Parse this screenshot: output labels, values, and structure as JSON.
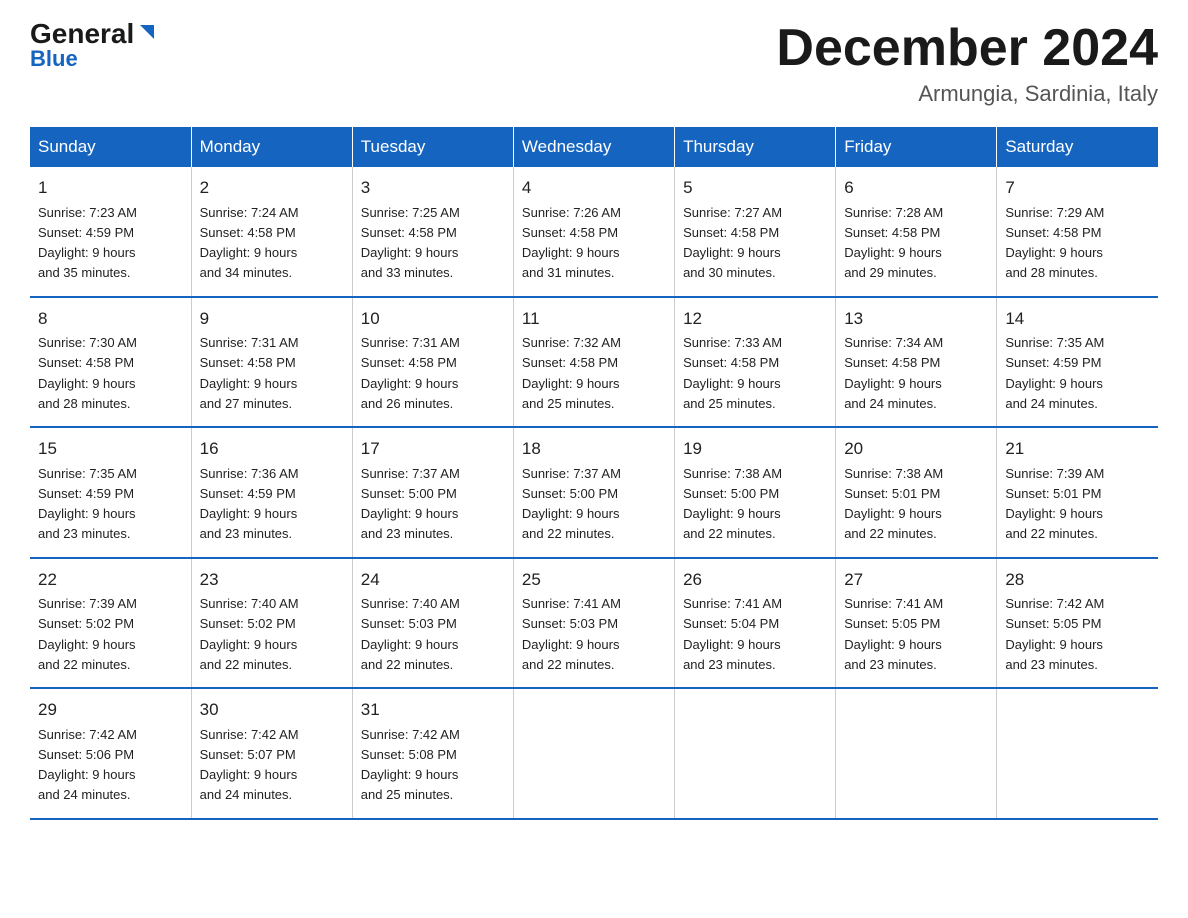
{
  "logo": {
    "general": "General",
    "blue": "Blue"
  },
  "title": "December 2024",
  "subtitle": "Armungia, Sardinia, Italy",
  "days_of_week": [
    "Sunday",
    "Monday",
    "Tuesday",
    "Wednesday",
    "Thursday",
    "Friday",
    "Saturday"
  ],
  "weeks": [
    [
      {
        "day": "1",
        "sunrise": "7:23 AM",
        "sunset": "4:59 PM",
        "daylight": "9 hours and 35 minutes."
      },
      {
        "day": "2",
        "sunrise": "7:24 AM",
        "sunset": "4:58 PM",
        "daylight": "9 hours and 34 minutes."
      },
      {
        "day": "3",
        "sunrise": "7:25 AM",
        "sunset": "4:58 PM",
        "daylight": "9 hours and 33 minutes."
      },
      {
        "day": "4",
        "sunrise": "7:26 AM",
        "sunset": "4:58 PM",
        "daylight": "9 hours and 31 minutes."
      },
      {
        "day": "5",
        "sunrise": "7:27 AM",
        "sunset": "4:58 PM",
        "daylight": "9 hours and 30 minutes."
      },
      {
        "day": "6",
        "sunrise": "7:28 AM",
        "sunset": "4:58 PM",
        "daylight": "9 hours and 29 minutes."
      },
      {
        "day": "7",
        "sunrise": "7:29 AM",
        "sunset": "4:58 PM",
        "daylight": "9 hours and 28 minutes."
      }
    ],
    [
      {
        "day": "8",
        "sunrise": "7:30 AM",
        "sunset": "4:58 PM",
        "daylight": "9 hours and 28 minutes."
      },
      {
        "day": "9",
        "sunrise": "7:31 AM",
        "sunset": "4:58 PM",
        "daylight": "9 hours and 27 minutes."
      },
      {
        "day": "10",
        "sunrise": "7:31 AM",
        "sunset": "4:58 PM",
        "daylight": "9 hours and 26 minutes."
      },
      {
        "day": "11",
        "sunrise": "7:32 AM",
        "sunset": "4:58 PM",
        "daylight": "9 hours and 25 minutes."
      },
      {
        "day": "12",
        "sunrise": "7:33 AM",
        "sunset": "4:58 PM",
        "daylight": "9 hours and 25 minutes."
      },
      {
        "day": "13",
        "sunrise": "7:34 AM",
        "sunset": "4:58 PM",
        "daylight": "9 hours and 24 minutes."
      },
      {
        "day": "14",
        "sunrise": "7:35 AM",
        "sunset": "4:59 PM",
        "daylight": "9 hours and 24 minutes."
      }
    ],
    [
      {
        "day": "15",
        "sunrise": "7:35 AM",
        "sunset": "4:59 PM",
        "daylight": "9 hours and 23 minutes."
      },
      {
        "day": "16",
        "sunrise": "7:36 AM",
        "sunset": "4:59 PM",
        "daylight": "9 hours and 23 minutes."
      },
      {
        "day": "17",
        "sunrise": "7:37 AM",
        "sunset": "5:00 PM",
        "daylight": "9 hours and 23 minutes."
      },
      {
        "day": "18",
        "sunrise": "7:37 AM",
        "sunset": "5:00 PM",
        "daylight": "9 hours and 22 minutes."
      },
      {
        "day": "19",
        "sunrise": "7:38 AM",
        "sunset": "5:00 PM",
        "daylight": "9 hours and 22 minutes."
      },
      {
        "day": "20",
        "sunrise": "7:38 AM",
        "sunset": "5:01 PM",
        "daylight": "9 hours and 22 minutes."
      },
      {
        "day": "21",
        "sunrise": "7:39 AM",
        "sunset": "5:01 PM",
        "daylight": "9 hours and 22 minutes."
      }
    ],
    [
      {
        "day": "22",
        "sunrise": "7:39 AM",
        "sunset": "5:02 PM",
        "daylight": "9 hours and 22 minutes."
      },
      {
        "day": "23",
        "sunrise": "7:40 AM",
        "sunset": "5:02 PM",
        "daylight": "9 hours and 22 minutes."
      },
      {
        "day": "24",
        "sunrise": "7:40 AM",
        "sunset": "5:03 PM",
        "daylight": "9 hours and 22 minutes."
      },
      {
        "day": "25",
        "sunrise": "7:41 AM",
        "sunset": "5:03 PM",
        "daylight": "9 hours and 22 minutes."
      },
      {
        "day": "26",
        "sunrise": "7:41 AM",
        "sunset": "5:04 PM",
        "daylight": "9 hours and 23 minutes."
      },
      {
        "day": "27",
        "sunrise": "7:41 AM",
        "sunset": "5:05 PM",
        "daylight": "9 hours and 23 minutes."
      },
      {
        "day": "28",
        "sunrise": "7:42 AM",
        "sunset": "5:05 PM",
        "daylight": "9 hours and 23 minutes."
      }
    ],
    [
      {
        "day": "29",
        "sunrise": "7:42 AM",
        "sunset": "5:06 PM",
        "daylight": "9 hours and 24 minutes."
      },
      {
        "day": "30",
        "sunrise": "7:42 AM",
        "sunset": "5:07 PM",
        "daylight": "9 hours and 24 minutes."
      },
      {
        "day": "31",
        "sunrise": "7:42 AM",
        "sunset": "5:08 PM",
        "daylight": "9 hours and 25 minutes."
      },
      null,
      null,
      null,
      null
    ]
  ],
  "labels": {
    "sunrise": "Sunrise:",
    "sunset": "Sunset:",
    "daylight": "Daylight:"
  }
}
